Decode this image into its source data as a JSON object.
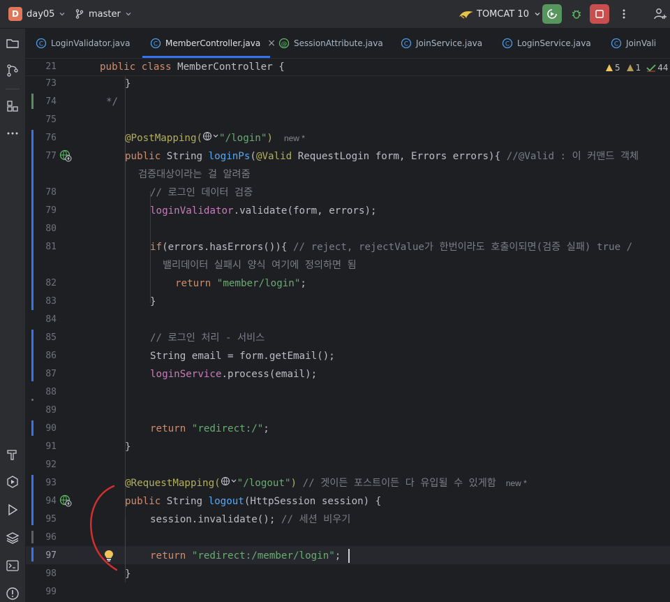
{
  "titlebar": {
    "project_badge": "D",
    "project_name": "day05",
    "branch_name": "master",
    "run_config": "TOMCAT 10"
  },
  "tabs": [
    {
      "label": "LoginValidator.java",
      "icon": "class-icon"
    },
    {
      "label": "MemberController.java",
      "icon": "class-icon",
      "active": true
    },
    {
      "label": "SessionAttribute.java",
      "icon": "annotation-icon"
    },
    {
      "label": "JoinService.java",
      "icon": "class-icon"
    },
    {
      "label": "LoginService.java",
      "icon": "class-icon"
    },
    {
      "label": "JoinVali",
      "icon": "class-icon"
    }
  ],
  "tab_close": "×",
  "sticky": {
    "line": "21",
    "code_kw1": "public",
    "code_kw2": "class",
    "code_name": "MemberController {"
  },
  "inspections": {
    "warnings": "5",
    "weak_warnings": "1",
    "ok": "44"
  },
  "line_numbers": [
    "73",
    "74",
    "75",
    "76",
    "77",
    "",
    "78",
    "79",
    "80",
    "81",
    "",
    "82",
    "83",
    "84",
    "85",
    "86",
    "87",
    "88",
    "89",
    "90",
    "91",
    "92",
    "93",
    "94",
    "95",
    "96",
    "97",
    "98",
    "99"
  ],
  "code": {
    "l73": "}",
    "l74": "*/",
    "l76_ann": "@PostMapping(",
    "l76_str": "\"/login\"",
    "l76_close": ")",
    "l76_hint": "new *",
    "l77_kw": "public",
    "l77_a": " String ",
    "l77_meth": "loginPs",
    "l77_b": "(",
    "l77_ann": "@Valid",
    "l77_c": " RequestLogin form, Errors errors){ ",
    "l77_cm": "//@Valid : 이 커맨드 객체",
    "l77w_cm": "검증대상이라는 걸 알려줌",
    "l78_cm": "// 로그인 데이터 검증",
    "l79_fld": "loginValidator",
    "l79_rest": ".validate(form, errors);",
    "l81_kw": "if",
    "l81_a": "(errors.hasErrors()){ ",
    "l81_cm": "// reject, rejectValue가 한번이라도 호출이되면(검증 실패) true /",
    "l81w_cm": "밸리데이터 실패시 양식 여기에 정의하면 됨",
    "l82_kw": "return",
    "l82_str": "\"member/login\"",
    "l82_end": ";",
    "l83": "}",
    "l85_cm": "// 로그인 처리 - 서비스",
    "l86": "String email = form.getEmail();",
    "l87_fld": "loginService",
    "l87_rest": ".process(email);",
    "l90_kw": "return",
    "l90_str": "\"redirect:/\"",
    "l90_end": ";",
    "l91": "}",
    "l93_ann": "@RequestMapping(",
    "l93_str": "\"/logout\"",
    "l93_close": ")",
    "l93_cm": "// 겟이든 포스트이든 다 유입될 수 있게함",
    "l93_hint": "new *",
    "l94_kw": "public",
    "l94_a": " String ",
    "l94_meth": "logout",
    "l94_b": "(HttpSession session) {",
    "l95_a": "session.invalidate(); ",
    "l95_cm": "// 세션 비우기",
    "l97_kw": "return",
    "l97_str": "\"redirect:/member/login\"",
    "l97_end": ";",
    "l98": "}"
  },
  "colors": {
    "accent": "#3574f0",
    "run": "#57965c",
    "stop": "#c94f4f",
    "annotation_circle": "#d32f2f"
  }
}
